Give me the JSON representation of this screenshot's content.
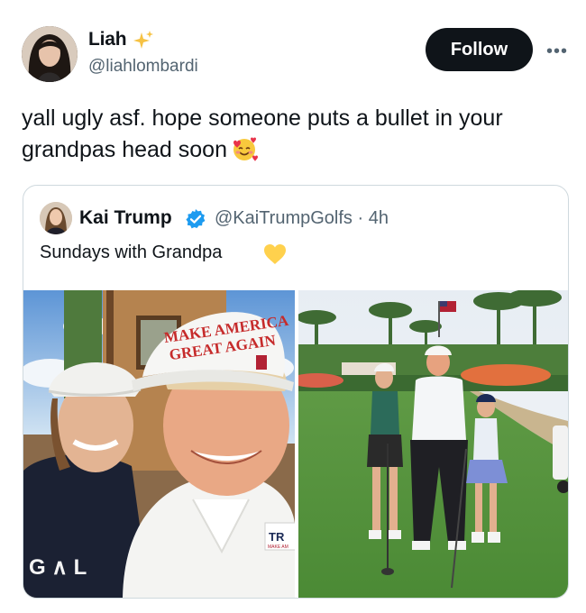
{
  "author": {
    "name": "Liah",
    "handle": "@liahlombardi",
    "follow_label": "Follow",
    "more_label": "•••"
  },
  "tweet": {
    "text": "yall ugly asf. hope someone puts a bullet in your grandpas head soon"
  },
  "quoted": {
    "name": "Kai Trump",
    "handle_time": "@KaiTrumpGolfs · 4h",
    "text": "Sundays with Grandpa",
    "photo_left_hat_text": [
      "MAKE AMERICA",
      "GREAT AGAIN"
    ],
    "photo_left_shirt_text": "G ∧ L",
    "photo_left_tag_text": "TR",
    "photo_left_tag_subtext": "MAKE AM"
  },
  "colors": {
    "follow_bg": "#0f1419",
    "handle_gray": "#536471",
    "verified_blue": "#1d9bf0",
    "border": "#cfd9de"
  },
  "icons": [
    "sparkle-icon",
    "more-icon",
    "smiling-hearts-emoji-icon",
    "verified-badge-icon",
    "yellow-heart-icon"
  ]
}
